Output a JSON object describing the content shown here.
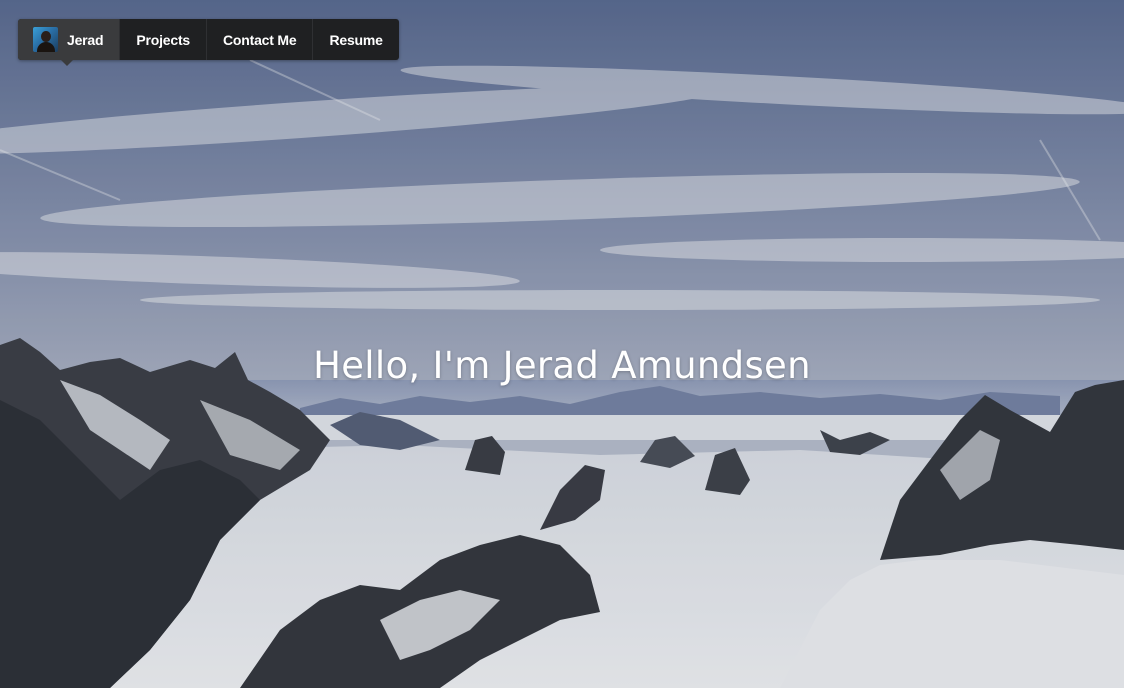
{
  "nav": {
    "items": [
      {
        "label": "Jerad",
        "active": true,
        "icon": "avatar"
      },
      {
        "label": "Projects",
        "active": false
      },
      {
        "label": "Contact Me",
        "active": false
      },
      {
        "label": "Resume",
        "active": false
      }
    ]
  },
  "hero": {
    "title": "Hello, I'm Jerad Amundsen",
    "background": "snowy-mountain-landscape"
  },
  "colors": {
    "navbar_bg": "#1f2022",
    "navbar_active_bg": "#3a3b3d",
    "text": "#ffffff"
  }
}
